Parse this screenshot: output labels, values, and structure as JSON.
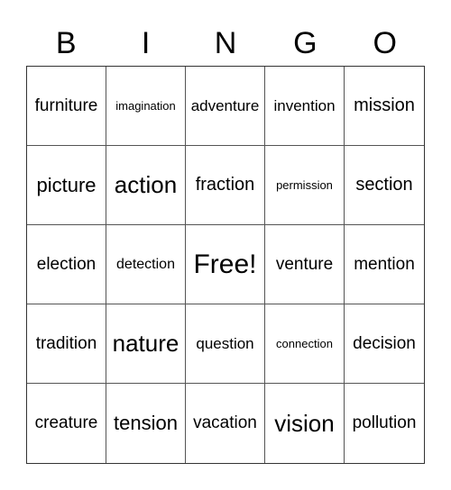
{
  "header": [
    "B",
    "I",
    "N",
    "G",
    "O"
  ],
  "cells": [
    [
      "furniture",
      "imagination",
      "adventure",
      "invention",
      "mission"
    ],
    [
      "picture",
      "action",
      "fraction",
      "permission",
      "section"
    ],
    [
      "election",
      "detection",
      "Free!",
      "venture",
      "mention"
    ],
    [
      "tradition",
      "nature",
      "question",
      "connection",
      "decision"
    ],
    [
      "creature",
      "tension",
      "vacation",
      "vision",
      "pollution"
    ]
  ]
}
